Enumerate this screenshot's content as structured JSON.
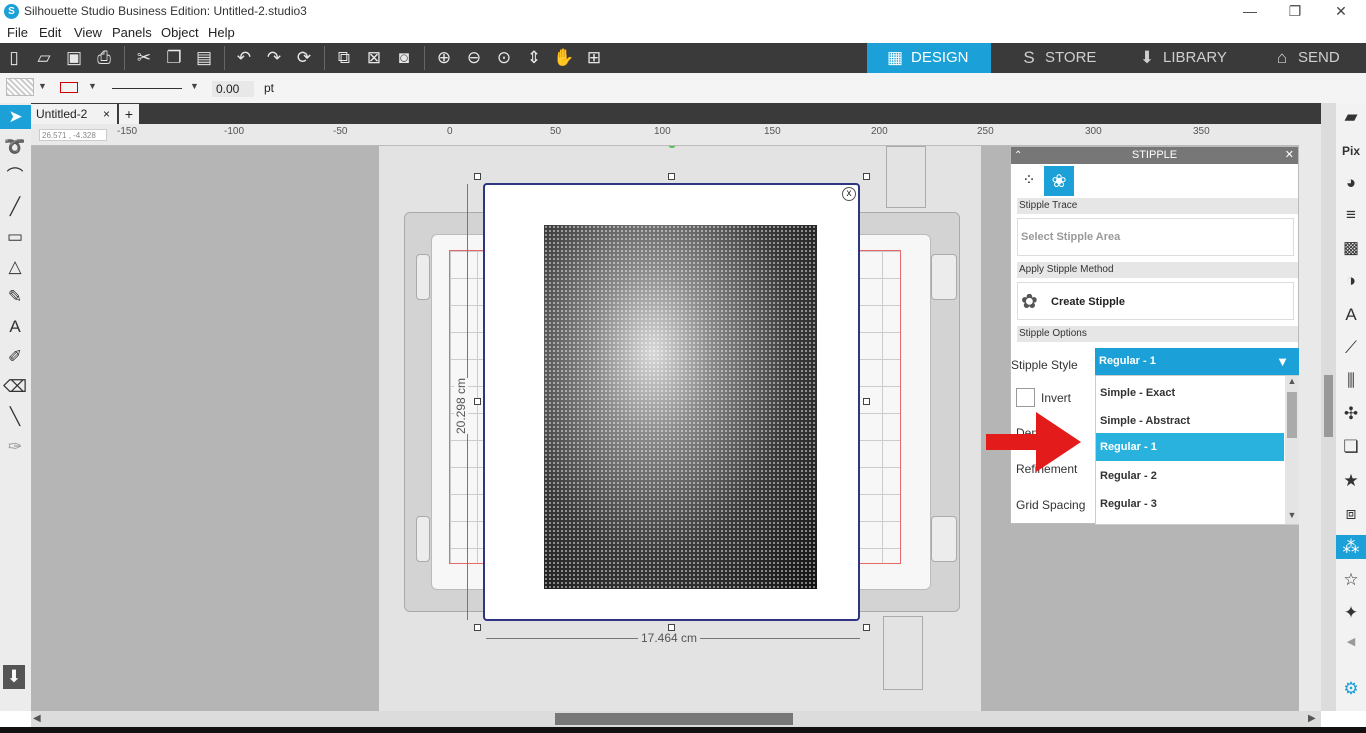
{
  "window": {
    "title": "Silhouette Studio Business Edition: Untitled-2.studio3",
    "app_icon": "S"
  },
  "menu": [
    "File",
    "Edit",
    "View",
    "Panels",
    "Object",
    "Help"
  ],
  "nav_tabs": [
    {
      "label": "DESIGN",
      "icon": "grid-icon",
      "active": true
    },
    {
      "label": "STORE",
      "icon": "s-icon",
      "active": false
    },
    {
      "label": "LIBRARY",
      "icon": "download-icon",
      "active": false
    },
    {
      "label": "SEND",
      "icon": "cutter-icon",
      "active": false
    }
  ],
  "options_bar": {
    "line_width": "0.00",
    "unit": "pt"
  },
  "document_tab": {
    "name": "Untitled-2",
    "close": "×",
    "add": "+"
  },
  "coord_readout": "26.571 , -4.328",
  "ruler_labels": [
    "-150",
    "-100",
    "-50",
    "0",
    "50",
    "100",
    "150",
    "200",
    "250",
    "300",
    "350"
  ],
  "dimensions": {
    "height": "20.298 cm",
    "width": "17.464 cm"
  },
  "panel": {
    "title": "STIPPLE",
    "stipple_trace_label": "Stipple Trace",
    "select_area_label": "Select Stipple Area",
    "apply_method_label": "Apply Stipple Method",
    "create_label": "Create Stipple",
    "options_label": "Stipple Options",
    "style_label": "Stipple Style",
    "style_value": "Regular - 1",
    "invert_label": "Invert",
    "density_label": "Density",
    "refinement_label": "Refinement",
    "grid_spacing_label": "Grid Spacing",
    "style_options": [
      {
        "label": "Simple - Exact",
        "selected": false
      },
      {
        "label": "Simple - Abstract",
        "selected": false
      },
      {
        "label": "Regular - 1",
        "selected": true
      },
      {
        "label": "Regular - 2",
        "selected": false
      },
      {
        "label": "Regular - 3",
        "selected": false
      }
    ]
  },
  "colors": {
    "accent": "#1ba0d8",
    "toolbar": "#3a3a3a",
    "arrow": "#e31b1b"
  }
}
